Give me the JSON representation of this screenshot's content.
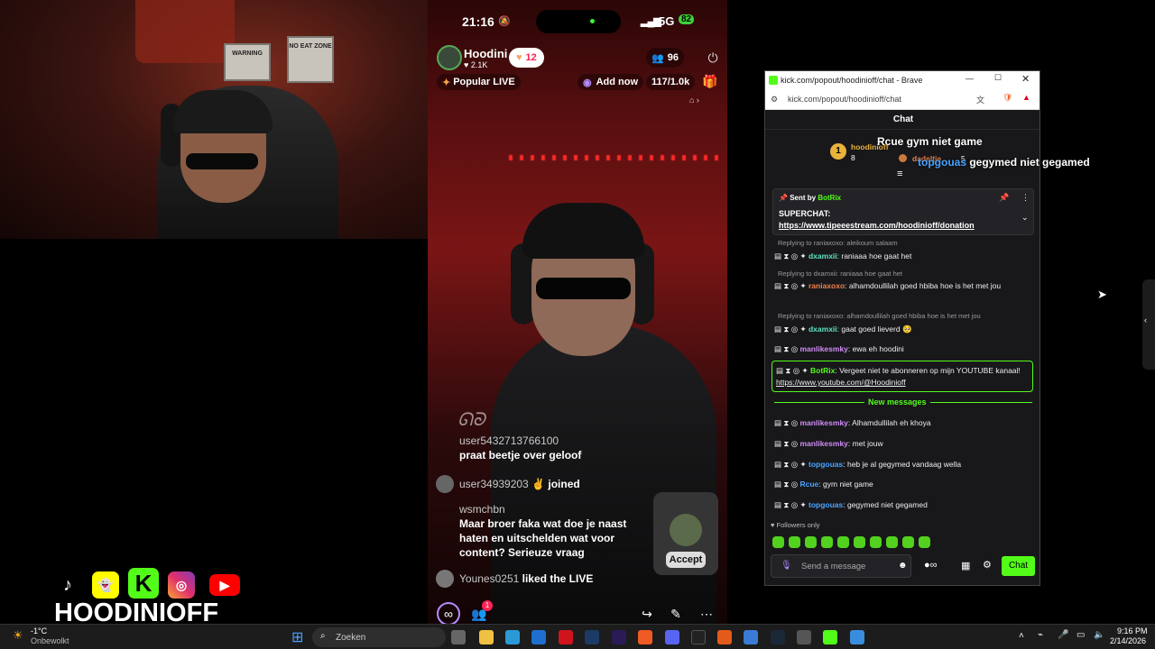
{
  "webcam": {
    "sign1": "WARNING",
    "sign2": "NO EAT ZONE"
  },
  "socials": {
    "brand": "HOODINIOFF",
    "kick_letter": "K"
  },
  "phone": {
    "status": {
      "time": "21:16",
      "network": "5G",
      "battery": "82"
    },
    "host": {
      "name": "Hoodini",
      "likes": "2.1K",
      "hearts": "12"
    },
    "viewers": "96",
    "popular": "Popular LIVE",
    "add_now": "Add now",
    "goal": "117/1.0k",
    "comments": [
      {
        "user": "user5432713766100",
        "text": "praat beetje over geloof"
      },
      {
        "user": "user34939203",
        "text": "joined"
      },
      {
        "user": "wsmchbn",
        "text": "Maar broer faka wat doe je naast haten en uitschelden wat voor content? Serieuze vraag"
      },
      {
        "user": "Younes0251",
        "text": "liked the LIVE"
      }
    ],
    "accept": "Accept",
    "badge_count": "1"
  },
  "browser": {
    "title": "kick.com/popout/hoodinioff/chat - Brave",
    "url": "kick.com/popout/hoodinioff/chat",
    "chat_header": "Chat",
    "leaderboard": [
      {
        "rank": "1",
        "name": "hoodinioff",
        "score": "8"
      },
      {
        "rank": "3",
        "name": "dadeltje",
        "score": "5"
      }
    ],
    "pinned": {
      "sent_by": "Sent by",
      "bot": "BotRix",
      "title": "SUPERCHAT:",
      "link": "https://www.tipeeestream.com/hoodinioff/donation"
    },
    "messages": [
      {
        "reply": "Replying to raniaxoxo: aleikoum salaam",
        "user": "dxamxii",
        "text": "raniaaa hoe gaat het"
      },
      {
        "reply": "Replying to dxamxii: raniaaa hoe gaat het",
        "user": "raniaxoxo",
        "text": "alhamdoullilah goed hbiba hoe is het met jou"
      },
      {
        "reply": "Replying to raniaxoxo: alhamdoullilah goed hbiba hoe is het met jou",
        "user": "dxamxii",
        "text": "gaat goed lieverd 🥺"
      },
      {
        "user": "manlikesmky",
        "text": "ewa eh hoodini"
      },
      {
        "user": "BotRix",
        "text": "Vergeet niet te abonneren op mijn YOUTUBE kanaal!",
        "link": "https://www.youtube.com/@Hoodinioff"
      },
      {
        "user": "manlikesmky",
        "text": "Alhamdullilah eh khoya"
      },
      {
        "user": "manlikesmky",
        "text": "met jouw"
      },
      {
        "user": "topgouas",
        "text": "heb je al gegymed vandaag wella"
      },
      {
        "user": "Rcue",
        "text": "gym niet game"
      },
      {
        "user": "topgouas",
        "text": "gegymed niet gegamed"
      }
    ],
    "new_messages": "New messages",
    "followers_only": "Followers only",
    "input_placeholder": "Send a message",
    "send_label": "Chat"
  },
  "overlay": {
    "line1": "Rcue gym niet game",
    "line2_user": "topgouas",
    "line2_text": "gegymed niet gegamed"
  },
  "taskbar": {
    "temp": "-1°C",
    "weather": "Onbewolkt",
    "search": "Zoeken",
    "time": "9:16 PM",
    "date": "2/14/2026"
  }
}
